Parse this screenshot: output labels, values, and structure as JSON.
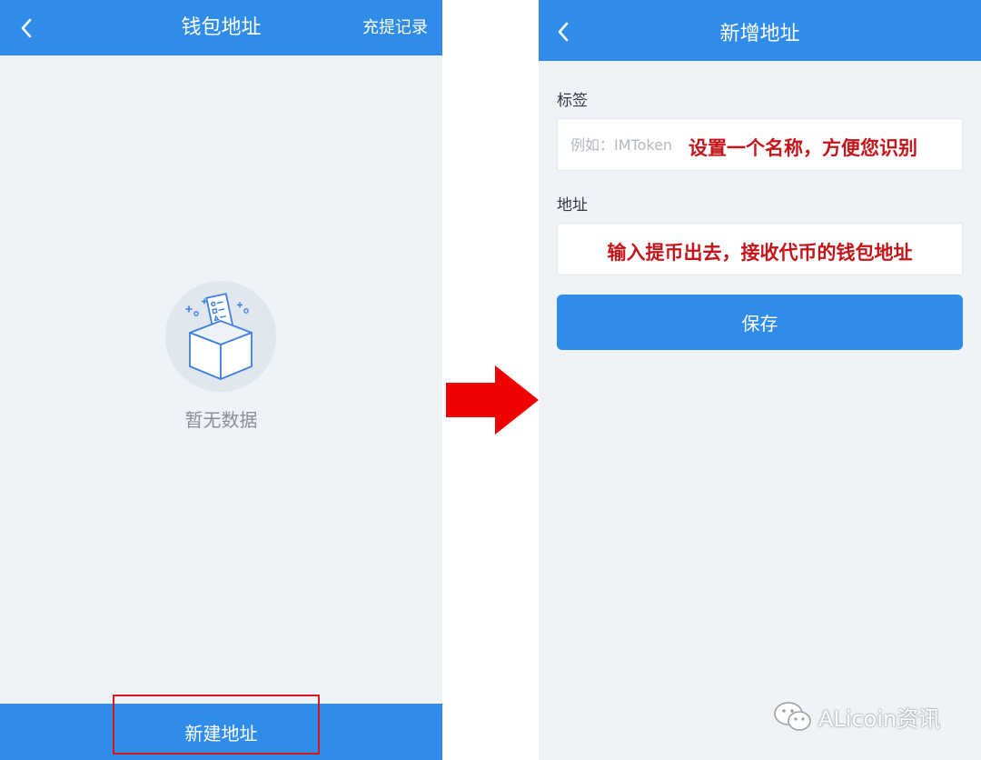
{
  "left_screen": {
    "header": {
      "title": "钱包地址",
      "right_link": "充提记录",
      "back_icon": "chevron-left-icon"
    },
    "empty_state": {
      "icon": "empty-box-icon",
      "text": "暂无数据"
    },
    "bottom_button": {
      "label": "新建地址"
    }
  },
  "transition": {
    "icon": "red-arrow-right-icon"
  },
  "right_screen": {
    "header": {
      "title": "新增地址",
      "back_icon": "chevron-left-icon"
    },
    "label_field": {
      "caption": "标签",
      "placeholder": "例如：IMToken",
      "value": "",
      "annotation": "设置一个名称，方便您识别"
    },
    "address_field": {
      "caption": "地址",
      "placeholder": "",
      "value": "",
      "annotation": "输入提币出去，接收代币的钱包地址"
    },
    "save_button": {
      "label": "保存"
    }
  },
  "watermark": {
    "icon": "wechat-icon",
    "text": "ALicoin资讯"
  },
  "colors": {
    "header_blue": "#2f8ce9",
    "page_bg": "#eff2f7",
    "annotation_red": "#c4141a",
    "arrow_red": "#f00000"
  }
}
